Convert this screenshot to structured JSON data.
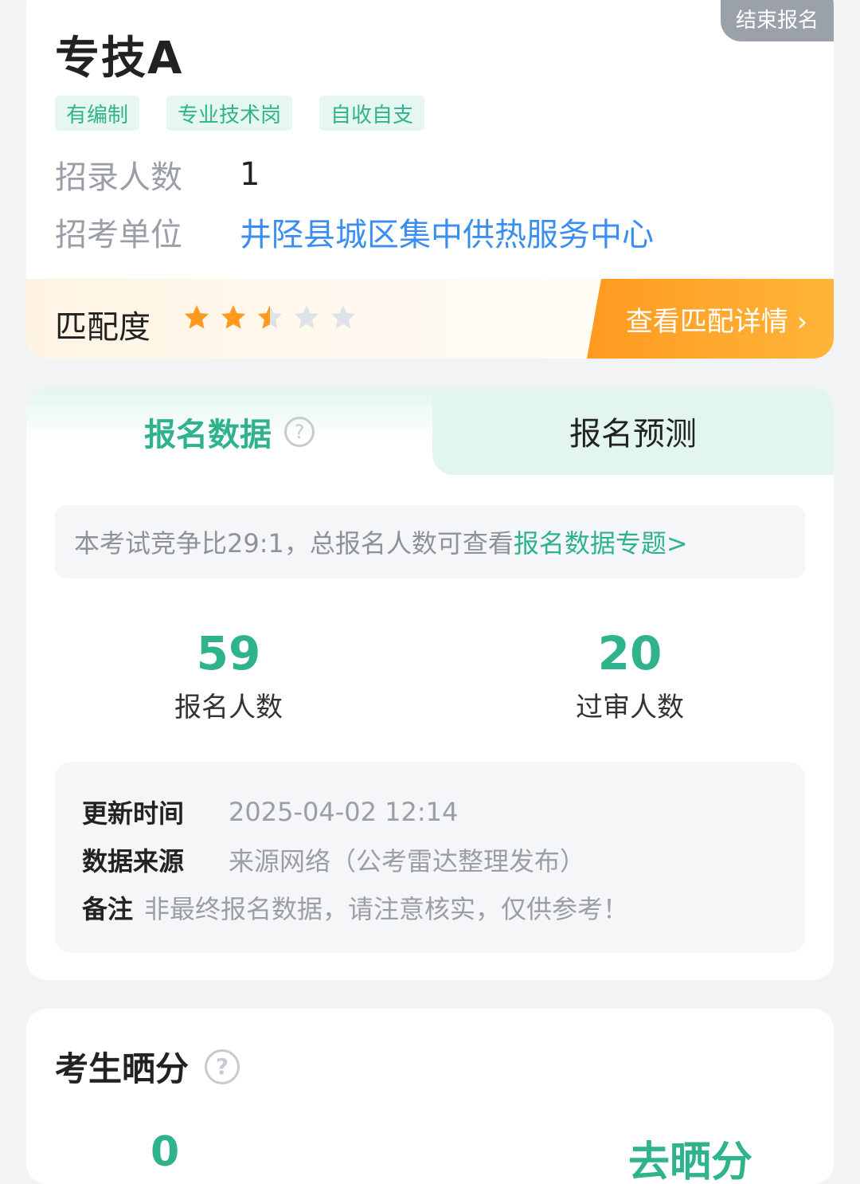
{
  "position": {
    "title": "专技A",
    "status": "结束报名",
    "tags": [
      "有编制",
      "专业技术岗",
      "自收自支"
    ],
    "recruit_label": "招录人数",
    "recruit_value": "1",
    "unit_label": "招考单位",
    "unit_value": "井陉县城区集中供热服务中心",
    "match_label": "匹配度",
    "match_rating": 2.5,
    "match_rating_max": 5,
    "match_button": "查看匹配详情 ›"
  },
  "registration": {
    "tab_active": "报名数据",
    "tab_inactive": "报名预测",
    "notice_text": "本考试竞争比29:1，总报名人数可查看",
    "notice_link": "报名数据专题>",
    "stats": [
      {
        "value": "59",
        "label": "报名人数"
      },
      {
        "value": "20",
        "label": "过审人数"
      }
    ],
    "update_label": "更新时间",
    "update_value": "2025-04-02 12:14",
    "source_label": "数据来源",
    "source_value": "来源网络（公考雷达整理发布）",
    "remark_label": "备注",
    "remark_value": "非最终报名数据，请注意核实，仅供参考！"
  },
  "scores": {
    "title": "考生晒分",
    "peek_left": "0",
    "peek_right": "去晒分"
  },
  "colors": {
    "accent": "#2fb38c",
    "link": "#3a8ef0",
    "orange": "#ff9a1f",
    "star_active": "#ff9a1f",
    "star_inactive": "#dfe2e6"
  }
}
